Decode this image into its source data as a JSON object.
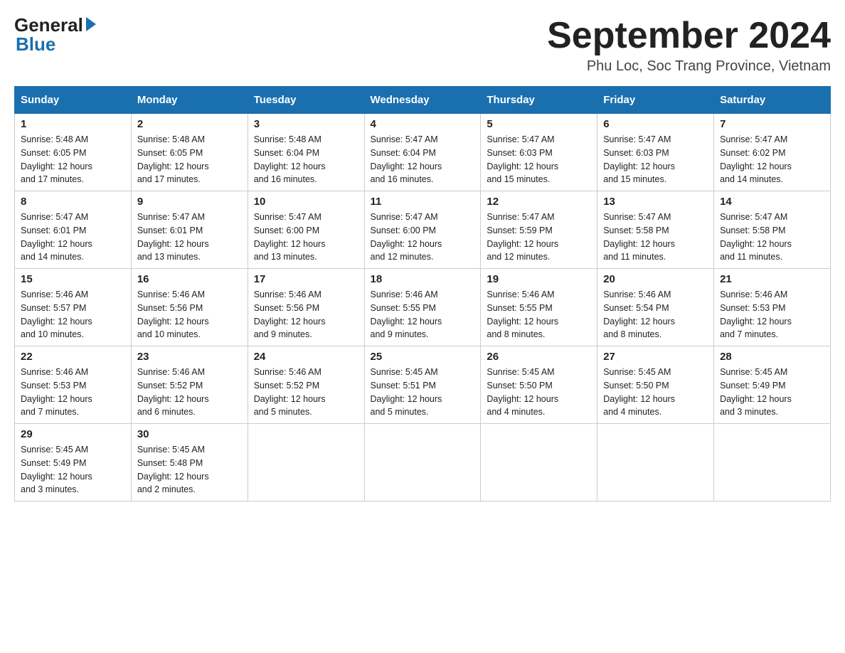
{
  "logo": {
    "general": "General",
    "blue": "Blue"
  },
  "title": {
    "month": "September 2024",
    "location": "Phu Loc, Soc Trang Province, Vietnam"
  },
  "days_of_week": [
    "Sunday",
    "Monday",
    "Tuesday",
    "Wednesday",
    "Thursday",
    "Friday",
    "Saturday"
  ],
  "weeks": [
    [
      {
        "day": "1",
        "sunrise": "5:48 AM",
        "sunset": "6:05 PM",
        "daylight": "12 hours and 17 minutes."
      },
      {
        "day": "2",
        "sunrise": "5:48 AM",
        "sunset": "6:05 PM",
        "daylight": "12 hours and 17 minutes."
      },
      {
        "day": "3",
        "sunrise": "5:48 AM",
        "sunset": "6:04 PM",
        "daylight": "12 hours and 16 minutes."
      },
      {
        "day": "4",
        "sunrise": "5:47 AM",
        "sunset": "6:04 PM",
        "daylight": "12 hours and 16 minutes."
      },
      {
        "day": "5",
        "sunrise": "5:47 AM",
        "sunset": "6:03 PM",
        "daylight": "12 hours and 15 minutes."
      },
      {
        "day": "6",
        "sunrise": "5:47 AM",
        "sunset": "6:03 PM",
        "daylight": "12 hours and 15 minutes."
      },
      {
        "day": "7",
        "sunrise": "5:47 AM",
        "sunset": "6:02 PM",
        "daylight": "12 hours and 14 minutes."
      }
    ],
    [
      {
        "day": "8",
        "sunrise": "5:47 AM",
        "sunset": "6:01 PM",
        "daylight": "12 hours and 14 minutes."
      },
      {
        "day": "9",
        "sunrise": "5:47 AM",
        "sunset": "6:01 PM",
        "daylight": "12 hours and 13 minutes."
      },
      {
        "day": "10",
        "sunrise": "5:47 AM",
        "sunset": "6:00 PM",
        "daylight": "12 hours and 13 minutes."
      },
      {
        "day": "11",
        "sunrise": "5:47 AM",
        "sunset": "6:00 PM",
        "daylight": "12 hours and 12 minutes."
      },
      {
        "day": "12",
        "sunrise": "5:47 AM",
        "sunset": "5:59 PM",
        "daylight": "12 hours and 12 minutes."
      },
      {
        "day": "13",
        "sunrise": "5:47 AM",
        "sunset": "5:58 PM",
        "daylight": "12 hours and 11 minutes."
      },
      {
        "day": "14",
        "sunrise": "5:47 AM",
        "sunset": "5:58 PM",
        "daylight": "12 hours and 11 minutes."
      }
    ],
    [
      {
        "day": "15",
        "sunrise": "5:46 AM",
        "sunset": "5:57 PM",
        "daylight": "12 hours and 10 minutes."
      },
      {
        "day": "16",
        "sunrise": "5:46 AM",
        "sunset": "5:56 PM",
        "daylight": "12 hours and 10 minutes."
      },
      {
        "day": "17",
        "sunrise": "5:46 AM",
        "sunset": "5:56 PM",
        "daylight": "12 hours and 9 minutes."
      },
      {
        "day": "18",
        "sunrise": "5:46 AM",
        "sunset": "5:55 PM",
        "daylight": "12 hours and 9 minutes."
      },
      {
        "day": "19",
        "sunrise": "5:46 AM",
        "sunset": "5:55 PM",
        "daylight": "12 hours and 8 minutes."
      },
      {
        "day": "20",
        "sunrise": "5:46 AM",
        "sunset": "5:54 PM",
        "daylight": "12 hours and 8 minutes."
      },
      {
        "day": "21",
        "sunrise": "5:46 AM",
        "sunset": "5:53 PM",
        "daylight": "12 hours and 7 minutes."
      }
    ],
    [
      {
        "day": "22",
        "sunrise": "5:46 AM",
        "sunset": "5:53 PM",
        "daylight": "12 hours and 7 minutes."
      },
      {
        "day": "23",
        "sunrise": "5:46 AM",
        "sunset": "5:52 PM",
        "daylight": "12 hours and 6 minutes."
      },
      {
        "day": "24",
        "sunrise": "5:46 AM",
        "sunset": "5:52 PM",
        "daylight": "12 hours and 5 minutes."
      },
      {
        "day": "25",
        "sunrise": "5:45 AM",
        "sunset": "5:51 PM",
        "daylight": "12 hours and 5 minutes."
      },
      {
        "day": "26",
        "sunrise": "5:45 AM",
        "sunset": "5:50 PM",
        "daylight": "12 hours and 4 minutes."
      },
      {
        "day": "27",
        "sunrise": "5:45 AM",
        "sunset": "5:50 PM",
        "daylight": "12 hours and 4 minutes."
      },
      {
        "day": "28",
        "sunrise": "5:45 AM",
        "sunset": "5:49 PM",
        "daylight": "12 hours and 3 minutes."
      }
    ],
    [
      {
        "day": "29",
        "sunrise": "5:45 AM",
        "sunset": "5:49 PM",
        "daylight": "12 hours and 3 minutes."
      },
      {
        "day": "30",
        "sunrise": "5:45 AM",
        "sunset": "5:48 PM",
        "daylight": "12 hours and 2 minutes."
      },
      null,
      null,
      null,
      null,
      null
    ]
  ],
  "labels": {
    "sunrise_prefix": "Sunrise: ",
    "sunset_prefix": "Sunset: ",
    "daylight_prefix": "Daylight: "
  }
}
